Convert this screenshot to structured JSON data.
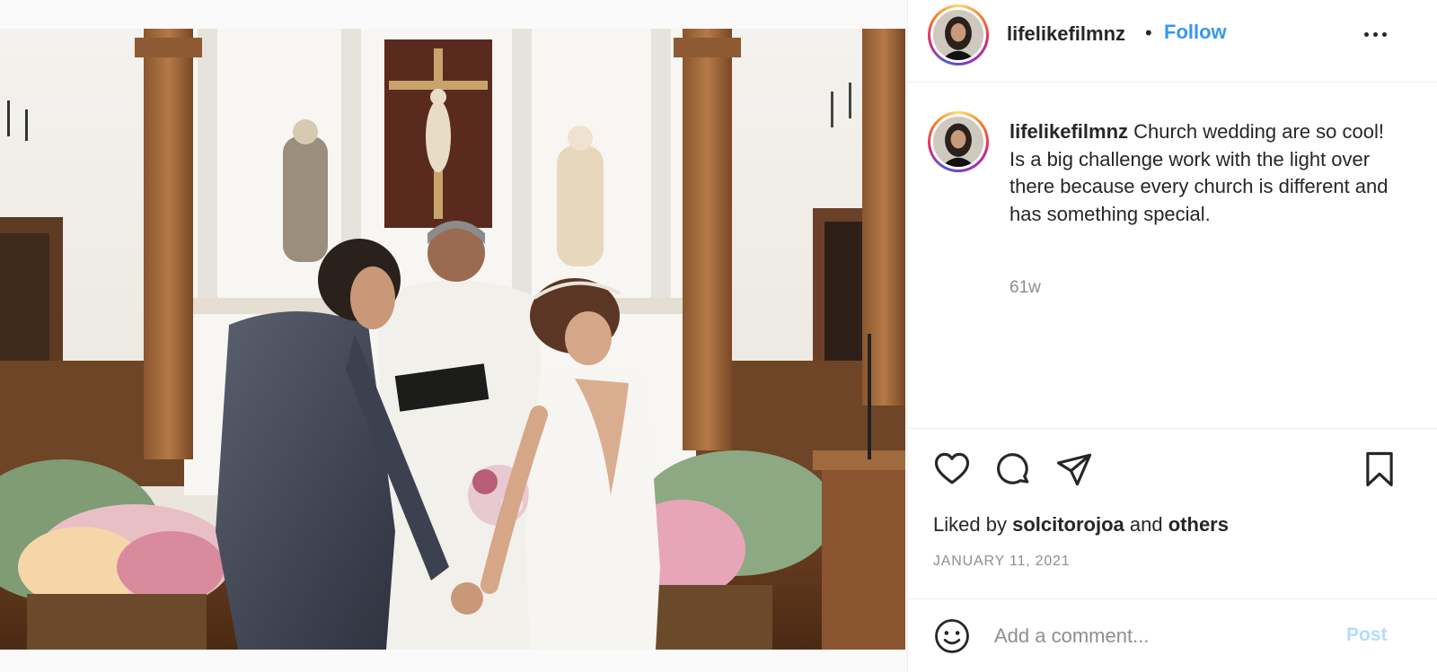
{
  "post": {
    "author": {
      "username": "lifelikefilmnz"
    },
    "header": {
      "separator": "•",
      "follow_label": "Follow",
      "more_icon": "more-horizontal-icon"
    },
    "caption": {
      "username": "lifelikefilmnz",
      "line1": "Church wedding are so cool!",
      "line2": "Is a big challenge work with the light over there because every church is different and has something special.",
      "time_ago": "61w"
    },
    "actions": {
      "like_icon": "heart-icon",
      "comment_icon": "comment-icon",
      "share_icon": "send-icon",
      "save_icon": "bookmark-icon"
    },
    "likes": {
      "prefix": "Liked by",
      "user": "solcitorojoa",
      "connector": "and",
      "others": "others"
    },
    "date": "JANUARY 11, 2021",
    "comment": {
      "emoji_icon": "smiley-icon",
      "placeholder": "Add a comment...",
      "post_label": "Post"
    },
    "colors": {
      "accent": "#3897f0",
      "post_disabled": "#b3dbff",
      "text": "#262626",
      "muted": "#8e8e8e"
    }
  }
}
